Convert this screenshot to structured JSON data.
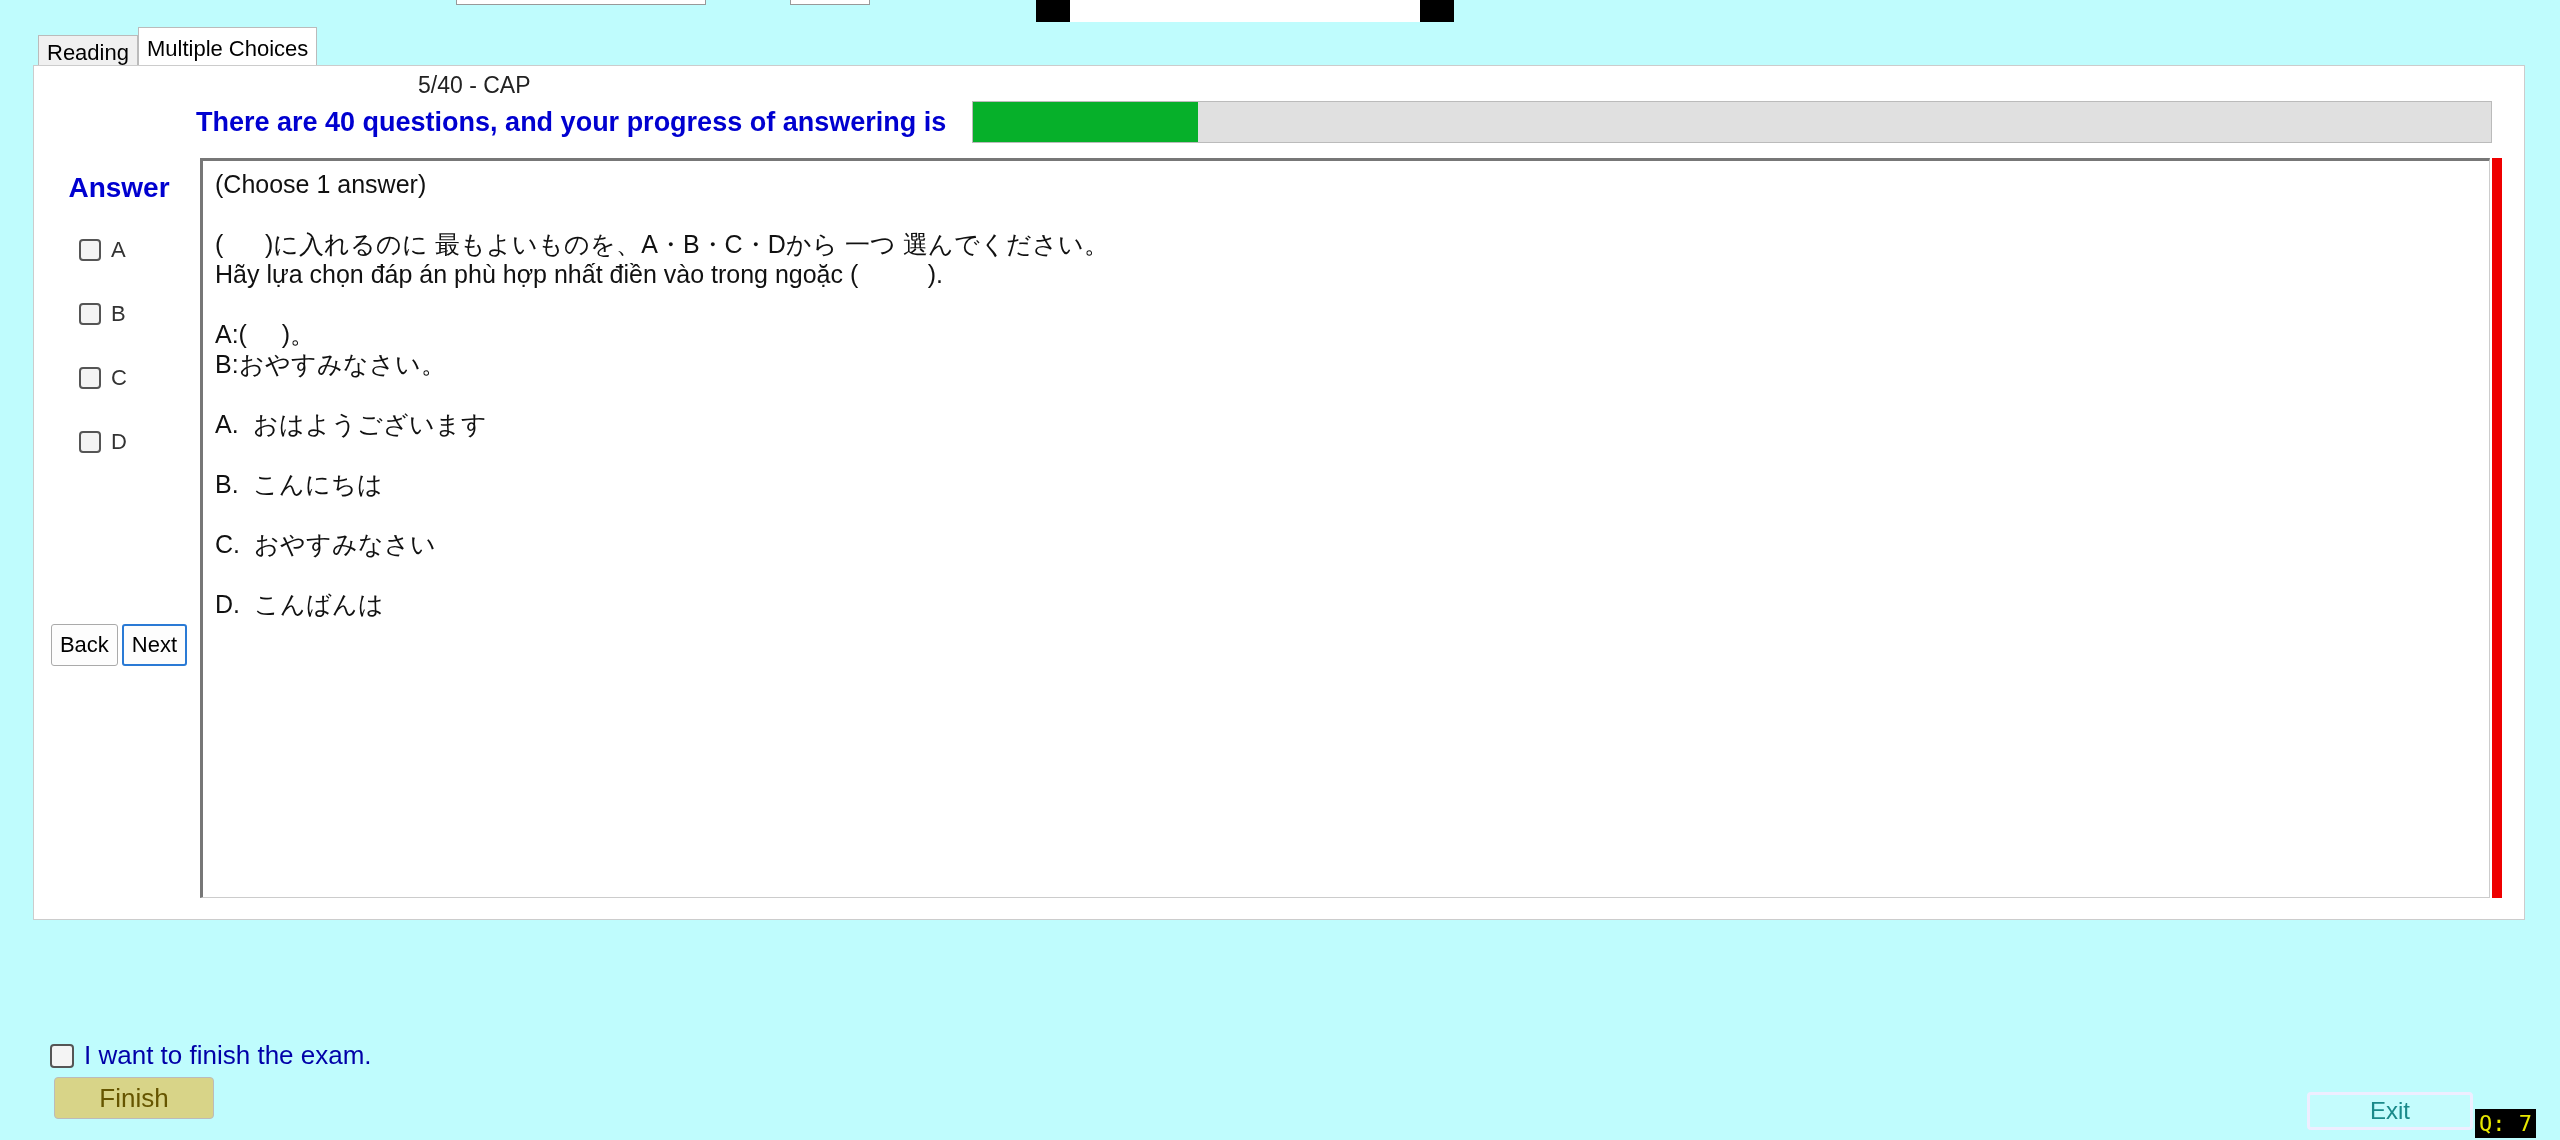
{
  "tabs": [
    {
      "label": "Reading",
      "selected": false
    },
    {
      "label": "Multiple Choices",
      "selected": true
    }
  ],
  "question_code": "5/40 - CAP",
  "progress": {
    "label": "There are 40 questions, and your progress of answering is",
    "level": 0.148
  },
  "answer": {
    "title": "Answer",
    "choices": [
      {
        "label": "A",
        "checked": false
      },
      {
        "label": "B",
        "checked": false
      },
      {
        "label": "C",
        "checked": false
      },
      {
        "label": "D",
        "checked": false
      }
    ]
  },
  "nav_buttons": [
    "Back",
    "Next"
  ],
  "question": {
    "instruction": "(Choose 1 answer)",
    "paragraphs": [
      [
        "(      )に入れるのに 最もよいものを、A・B・C・Dから 一つ 選んでください。",
        "Hãy lựa chọn đáp án phù hợp nhất điền vào trong ngoặc (          )."
      ],
      [
        "A:(     )。",
        "B:おやすみなさい。"
      ],
      [
        "A.  おはようございます"
      ],
      [
        "B.  こんにちは"
      ],
      [
        "C.  おやすみなさい"
      ],
      [
        "D.  こんばんは"
      ]
    ]
  },
  "finish": {
    "label": "I want to finish the exam.",
    "checked": false,
    "button": "Finish"
  },
  "exit_button": "Exit",
  "question_counter": "Q: 7"
}
